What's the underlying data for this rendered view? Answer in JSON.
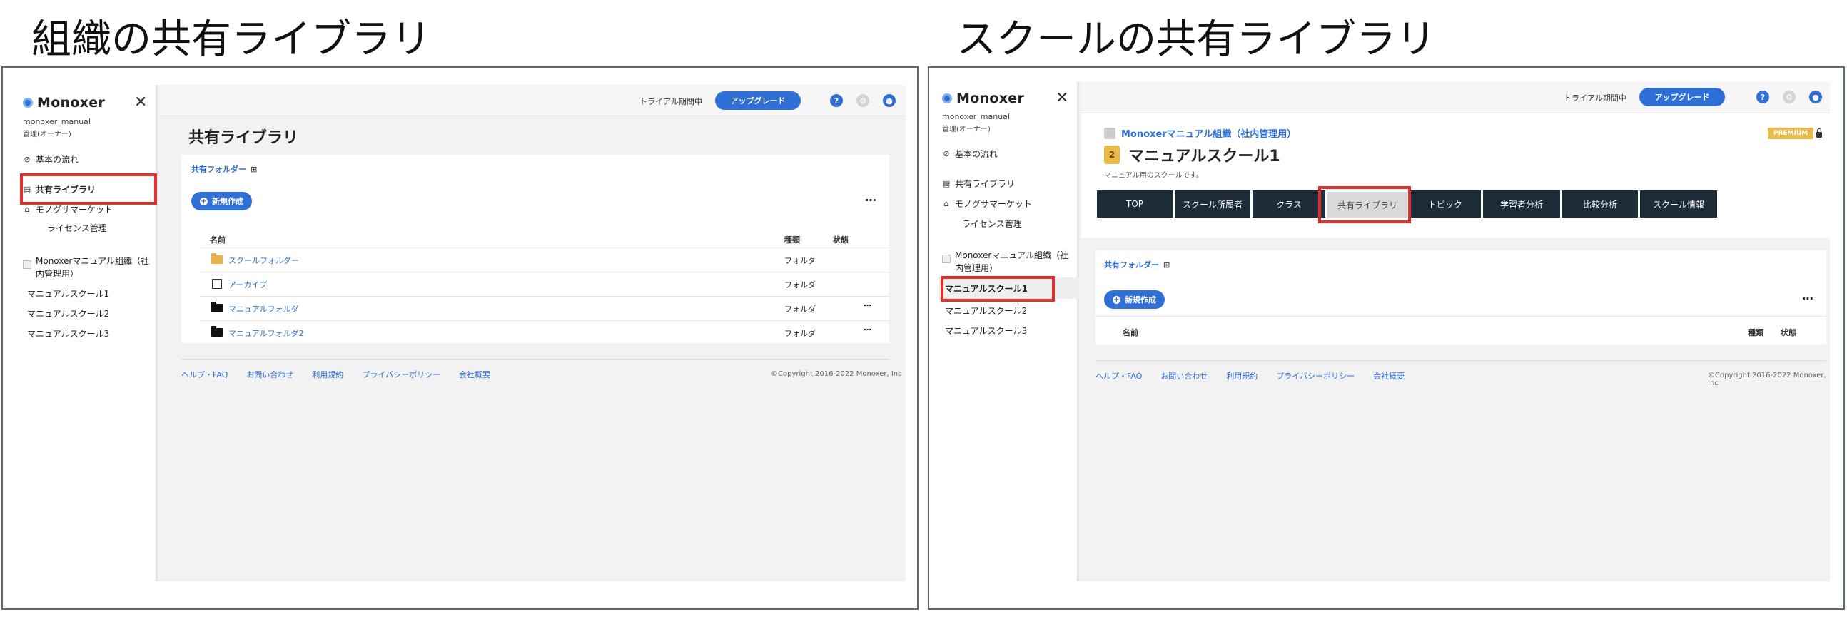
{
  "left_panel": {
    "heading": "組織の共有ライブラリ",
    "sidebar": {
      "logo": "Monoxer",
      "user_name": "monoxer_manual",
      "user_role": "管理(オーナー)",
      "items": [
        {
          "label": "基本の流れ",
          "icon": "check-circle-icon"
        },
        {
          "label": "共有ライブラリ",
          "icon": "library-icon"
        },
        {
          "label": "モノグサマーケット",
          "icon": "basket-icon"
        },
        {
          "label": "ライセンス管理",
          "icon": ""
        }
      ],
      "org_name": "Monoxerマニュアル組織（社内管理用）",
      "schools": [
        "マニュアルスクール1",
        "マニュアルスクール2",
        "マニュアルスクール3"
      ]
    },
    "topbar": {
      "trial": "トライアル期間中",
      "upgrade": "アップグレード"
    },
    "main": {
      "page_title": "共有ライブラリ",
      "breadcrumb": "共有フォルダー",
      "new_button": "新規作成",
      "columns": {
        "name": "名前",
        "type": "種類",
        "status": "状態"
      },
      "rows": [
        {
          "name": "スクールフォルダー",
          "type": "フォルダ",
          "icon": "school-folder-icon",
          "more": ""
        },
        {
          "name": "アーカイブ",
          "type": "フォルダ",
          "icon": "archive-icon",
          "more": ""
        },
        {
          "name": "マニュアルフォルダ",
          "type": "フォルダ",
          "icon": "folder-icon",
          "more": "⋯"
        },
        {
          "name": "マニュアルフォルダ2",
          "type": "フォルダ",
          "icon": "folder-icon",
          "more": "⋯"
        }
      ]
    },
    "footer": {
      "links": [
        "ヘルプ・FAQ",
        "お問い合わせ",
        "利用規約",
        "プライバシーポリシー",
        "会社概要"
      ],
      "copyright": "©Copyright 2016-2022 Monoxer, Inc"
    }
  },
  "right_panel": {
    "heading": "スクールの共有ライブラリ",
    "sidebar": {
      "logo": "Monoxer",
      "user_name": "monoxer_manual",
      "user_role": "管理(オーナー)",
      "items": [
        {
          "label": "基本の流れ",
          "icon": "check-circle-icon"
        },
        {
          "label": "共有ライブラリ",
          "icon": "library-icon"
        },
        {
          "label": "モノグサマーケット",
          "icon": "basket-icon"
        },
        {
          "label": "ライセンス管理",
          "icon": ""
        }
      ],
      "org_name": "Monoxerマニュアル組織（社内管理用）",
      "schools": [
        "マニュアルスクール1",
        "マニュアルスクール2",
        "マニュアルスクール3"
      ]
    },
    "topbar": {
      "trial": "トライアル期間中",
      "upgrade": "アップグレード"
    },
    "main": {
      "org_link": "Monoxerマニュアル組織（社内管理用）",
      "school_title": "マニュアルスクール1",
      "school_desc": "マニュアル用のスクールです。",
      "premium": "PREMIUM",
      "tabs": [
        "TOP",
        "スクール所属者",
        "クラス",
        "共有ライブラリ",
        "トピック",
        "学習者分析",
        "比較分析",
        "スクール情報"
      ],
      "breadcrumb": "共有フォルダー",
      "new_button": "新規作成",
      "columns": {
        "name": "名前",
        "type": "種類",
        "status": "状態"
      }
    },
    "footer": {
      "links": [
        "ヘルプ・FAQ",
        "お問い合わせ",
        "利用規約",
        "プライバシーポリシー",
        "会社概要"
      ],
      "copyright": "©Copyright 2016-2022 Monoxer, Inc"
    }
  },
  "colors": {
    "accent": "#2f6fd6",
    "highlight": "#e03131",
    "tab_dark": "#1e2b38",
    "premium": "#e9b94a"
  }
}
